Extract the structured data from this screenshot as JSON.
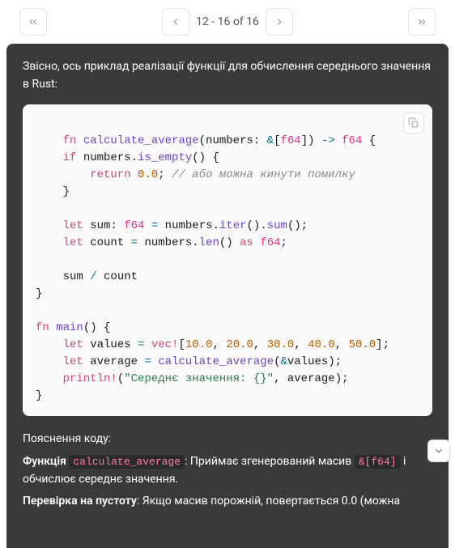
{
  "pagination": {
    "range": "12 - 16 of 16"
  },
  "intro": "Звісно, ось приклад реалізації функції для обчислення середнього значення в Rust:",
  "code": {
    "l1": {
      "fn": "fn",
      "name": "calculate_average",
      "sig1": "(numbers: ",
      "amp": "&",
      "br1": "[",
      "ty": "f64",
      "br2": "]) ",
      "arrow": "->",
      "sp": " ",
      "ret": "f64",
      "open": " {"
    },
    "l2": {
      "kw": "if",
      "sp": " numbers.",
      "m": "is_empty",
      "rest": "() {"
    },
    "l3": {
      "kw": "return",
      "sp": " ",
      "val": "0.0",
      "semi": ";",
      "sp2": " ",
      "cm": "// або можна кинути помилку"
    },
    "l4": {
      "close": "}"
    },
    "l6": {
      "kw": "let",
      "rest": " sum: ",
      "ty": "f64",
      "sp": " ",
      "eq": "=",
      "rest2": " numbers.",
      "m1": "iter",
      "p1": "().",
      "m2": "sum",
      "p2": "();"
    },
    "l7": {
      "kw": "let",
      "rest": " count ",
      "eq": "=",
      "rest2": " numbers.",
      "m": "len",
      "p": "() ",
      "as": "as",
      "sp": " ",
      "ty": "f64",
      "semi": ";"
    },
    "l9": {
      "a": "sum ",
      "op": "/",
      "b": " count"
    },
    "l10": {
      "close": "}"
    },
    "l12": {
      "fn": "fn",
      "sp": " ",
      "name": "main",
      "rest": "() {"
    },
    "l13": {
      "kw": "let",
      "rest": " values ",
      "eq": "=",
      "sp": " ",
      "mc": "vec!",
      "br": "[",
      "v1": "10.0",
      "c1": ", ",
      "v2": "20.0",
      "c2": ", ",
      "v3": "30.0",
      "c3": ", ",
      "v4": "40.0",
      "c4": ", ",
      "v5": "50.0",
      "end": "];"
    },
    "l14": {
      "kw": "let",
      "rest": " average ",
      "eq": "=",
      "sp": " ",
      "fn": "calculate_average",
      "p": "(",
      "amp": "&",
      "rest2": "values);"
    },
    "l15": {
      "mc": "println!",
      "p1": "(",
      "st": "\"Середнє значення: {}\"",
      "rest": ", average);"
    },
    "l16": {
      "close": "}"
    }
  },
  "explain": {
    "heading": "Пояснення коду:",
    "p1a": "Функція ",
    "p1code": "calculate_average",
    "p1b": ": Приймає згенерований масив ",
    "p1code2": "&[f64]",
    "p1c": " і обчислює середнє значення.",
    "p2a": "Перевірка на пустоту",
    "p2b": ": Якщо масив порожній, повертається 0.0 (можна"
  }
}
